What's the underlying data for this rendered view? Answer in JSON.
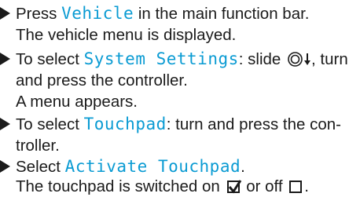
{
  "steps": [
    {
      "line1": {
        "pre": "Press ",
        "ui": "Vehicle",
        "post": " in the main function bar."
      },
      "line2": "The vehicle menu is displayed."
    },
    {
      "line1": {
        "pre": "To select ",
        "ui": "System Settings",
        "mid": ": slide ",
        "post": ", turn"
      },
      "line2": "and press the controller.",
      "line3": "A menu appears."
    },
    {
      "line1": {
        "pre": "To select ",
        "ui": "Touchpad",
        "post": ": turn and press the con-"
      },
      "line2": "troller."
    },
    {
      "line1": {
        "pre": "Select ",
        "ui": "Activate Touchpad",
        "post": "."
      },
      "line2": {
        "pre": "The touchpad is switched on ",
        "mid": " or off ",
        "post": "."
      }
    }
  ],
  "icons": {
    "controller": "controller-slide-icon",
    "arrow": "arrow-down-icon",
    "checked": "checkbox-checked-icon",
    "unchecked": "checkbox-unchecked-icon"
  },
  "colors": {
    "ui_text": "#0a9bd3",
    "body_text": "#1b1b1b"
  }
}
